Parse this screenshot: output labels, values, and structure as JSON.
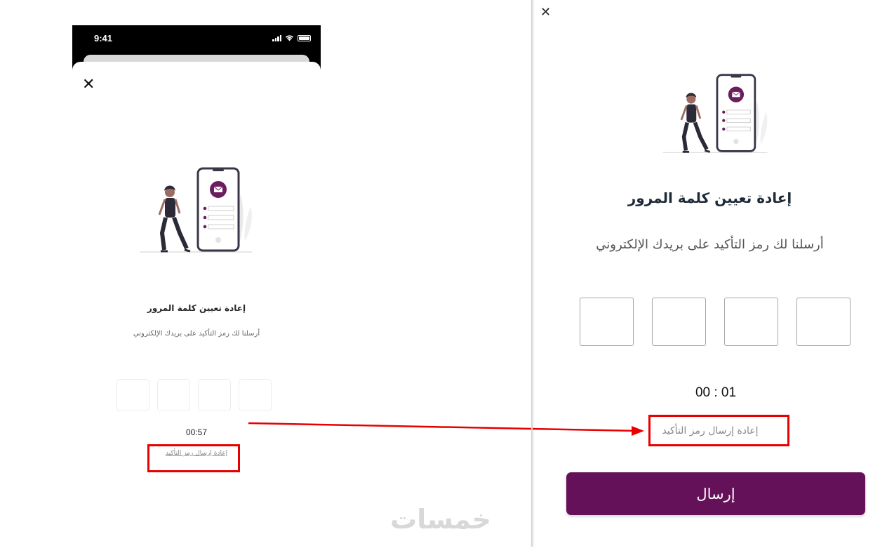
{
  "mobile": {
    "status_time": "9:41",
    "close_glyph": "✕",
    "title": "إعادة تعيين كلمة المرور",
    "subtitle": "أرسلنا لك رمز التأكيد على بريدك الإلكتروني",
    "otp_count": 4,
    "timer": "00:57",
    "resend_label": "إعادة إرسال رمز التأكيد"
  },
  "web": {
    "close_glyph": "✕",
    "title": "إعادة تعيين كلمة المرور",
    "subtitle": "أرسلنا لك رمز التأكيد على بريدك الإلكتروني",
    "otp_count": 4,
    "timer": "00 : 01",
    "resend_label": "إعادة إرسال رمز التأكيد",
    "send_button": "إرسال"
  },
  "watermark": "خمسات",
  "colors": {
    "brand_purple": "#65115a",
    "highlight_red": "#e80000",
    "illustration_purple": "#6b1e5e"
  },
  "icons": [
    "close-icon",
    "signal-icon",
    "wifi-icon",
    "battery-icon",
    "envelope-icon"
  ]
}
